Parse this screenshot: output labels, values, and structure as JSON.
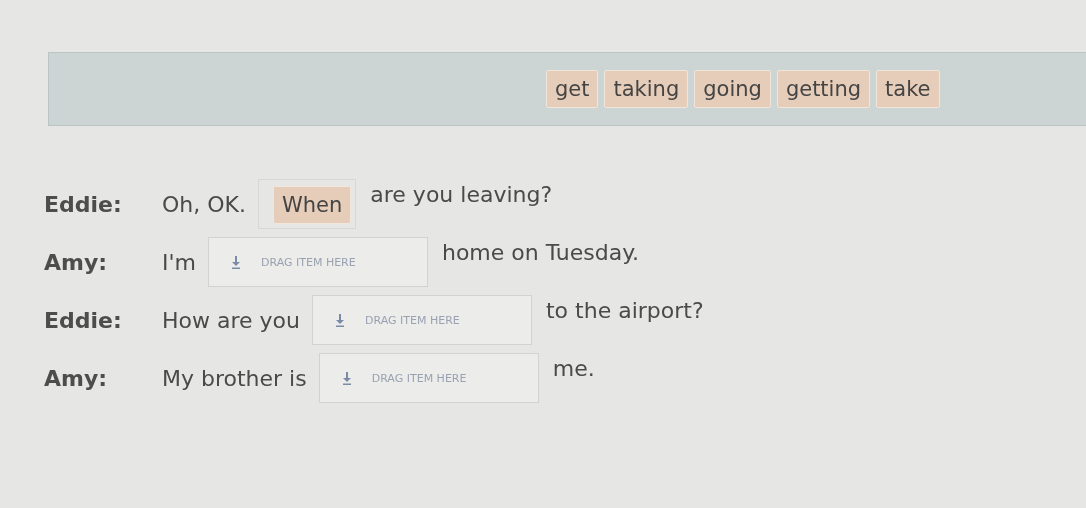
{
  "word_bank": [
    {
      "label": "get"
    },
    {
      "label": "taking"
    },
    {
      "label": "going"
    },
    {
      "label": "getting"
    },
    {
      "label": "take"
    }
  ],
  "dialogue": [
    {
      "speaker": "Eddie:",
      "before": "Oh, OK.",
      "slot": {
        "kind": "filled",
        "label": "When"
      },
      "after": "are you leaving?"
    },
    {
      "speaker": "Amy:",
      "before": "I'm",
      "slot": {
        "kind": "empty",
        "label": "DRAG ITEM HERE"
      },
      "after": "home on Tuesday."
    },
    {
      "speaker": "Eddie:",
      "before": "How are you",
      "slot": {
        "kind": "empty",
        "label": "DRAG ITEM HERE"
      },
      "after": "to the airport?"
    },
    {
      "speaker": "Amy:",
      "before": "My brother is",
      "slot": {
        "kind": "empty",
        "label": "DRAG ITEM HERE"
      },
      "after": "me."
    }
  ]
}
